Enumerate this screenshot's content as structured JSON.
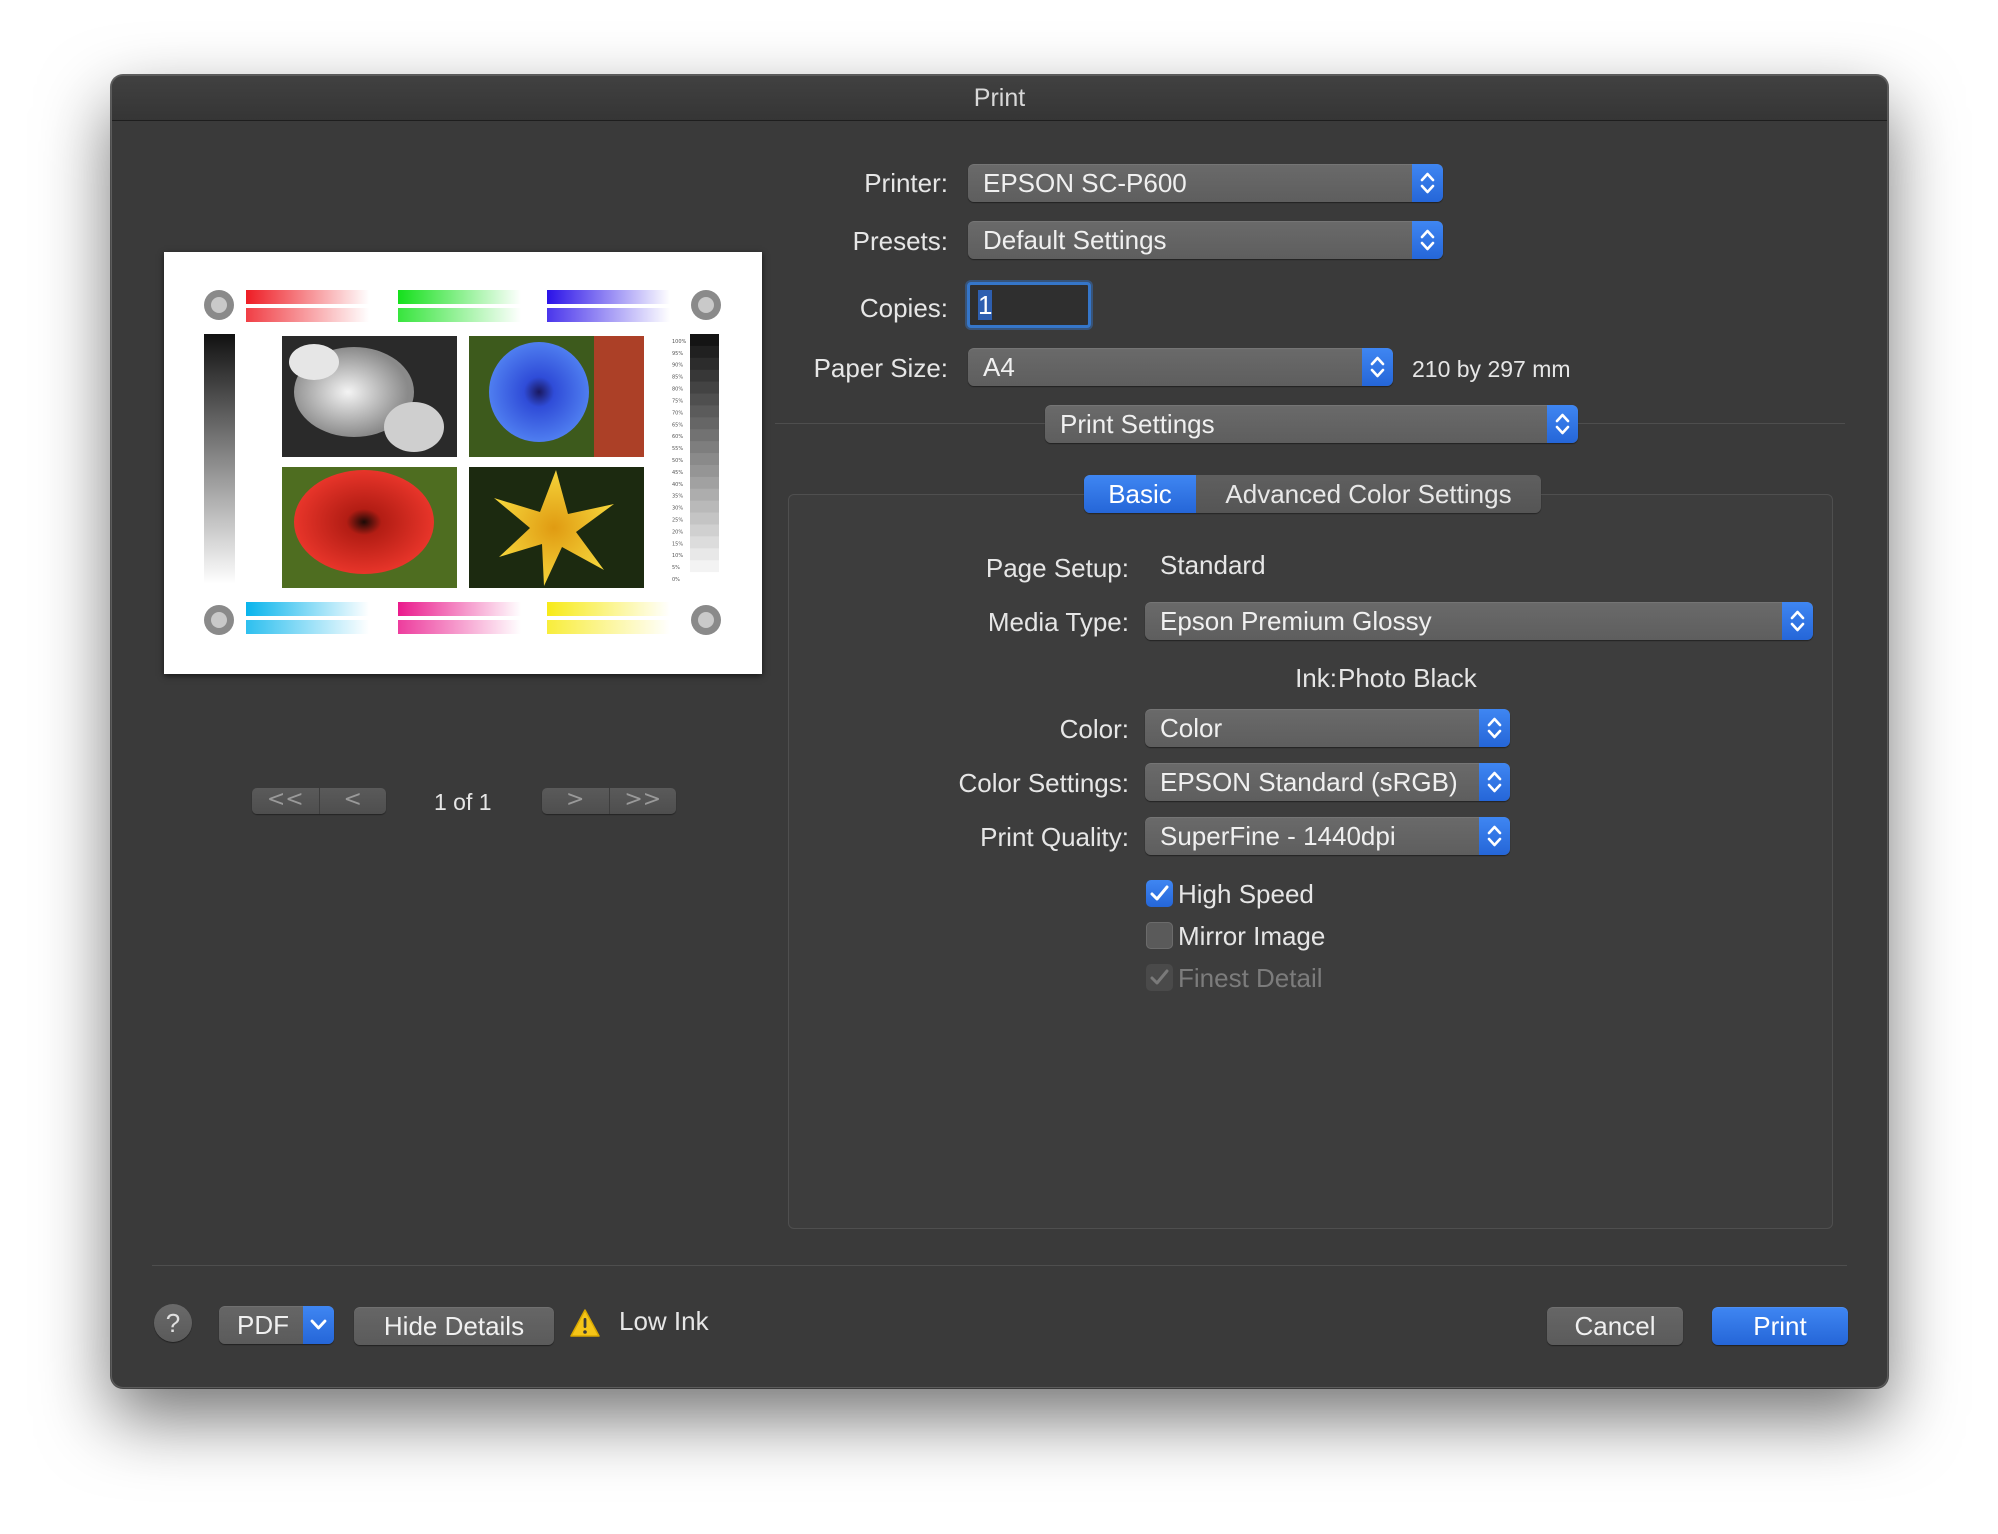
{
  "window": {
    "title": "Print"
  },
  "printer": {
    "label": "Printer:",
    "value": "EPSON SC-P600"
  },
  "presets": {
    "label": "Presets:",
    "value": "Default Settings"
  },
  "copies": {
    "label": "Copies:",
    "value": "1"
  },
  "paper_size": {
    "label": "Paper Size:",
    "value": "A4",
    "dimensions": "210 by 297 mm"
  },
  "section_popup": {
    "value": "Print Settings"
  },
  "tabs": [
    {
      "label": "Basic",
      "active": true
    },
    {
      "label": "Advanced Color Settings",
      "active": false
    }
  ],
  "settings": {
    "page_setup": {
      "label": "Page Setup:",
      "value": "Standard"
    },
    "media_type": {
      "label": "Media Type:",
      "value": "Epson Premium Glossy"
    },
    "ink": {
      "label": "Ink:",
      "value": "Photo Black"
    },
    "color": {
      "label": "Color:",
      "value": "Color"
    },
    "color_settings": {
      "label": "Color Settings:",
      "value": "EPSON Standard (sRGB)"
    },
    "print_quality": {
      "label": "Print Quality:",
      "value": "SuperFine - 1440dpi"
    },
    "checkboxes": [
      {
        "label": "High Speed",
        "checked": true,
        "enabled": true
      },
      {
        "label": "Mirror Image",
        "checked": false,
        "enabled": true
      },
      {
        "label": "Finest Detail",
        "checked": true,
        "enabled": false
      }
    ]
  },
  "preview": {
    "page_indicator": "1 of 1",
    "pager_left": [
      "<<",
      "<"
    ],
    "pager_right": [
      ">",
      ">>"
    ],
    "scale_labels": [
      "100%",
      "95%",
      "90%",
      "85%",
      "80%",
      "75%",
      "70%",
      "65%",
      "60%",
      "55%",
      "50%",
      "45%",
      "40%",
      "35%",
      "30%",
      "25%",
      "20%",
      "15%",
      "10%",
      "5%",
      "0%"
    ]
  },
  "footer": {
    "help": "?",
    "pdf": "PDF",
    "hide_details": "Hide Details",
    "warning": "Low Ink",
    "cancel": "Cancel",
    "print": "Print"
  },
  "colors": {
    "accent": "#2f74e6",
    "window_bg": "#3a3a3a",
    "control_bg": "#636363",
    "warning": "#f5c518"
  },
  "icons": [
    "updown-chevron-icon",
    "chevron-down-icon",
    "checkmark-icon",
    "warning-icon",
    "help-icon"
  ]
}
